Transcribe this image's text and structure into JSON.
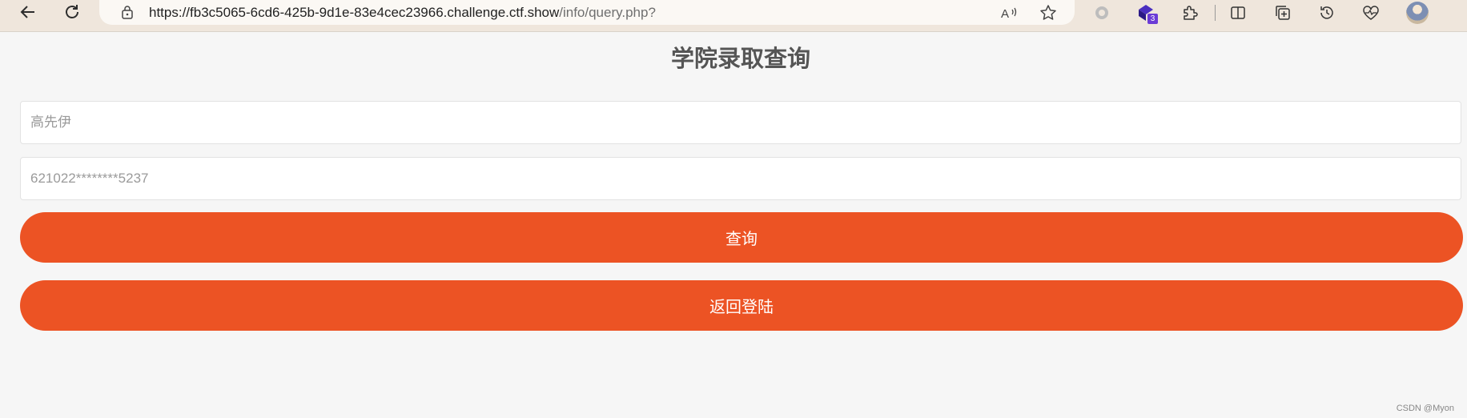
{
  "browser": {
    "url_host": "https://fb3c5065-6cd6-425b-9d1e-83e4cec23966.challenge.ctf.show",
    "url_path": "/info/query.php?",
    "extension_badge": "3",
    "icons": [
      "back-arrow-icon",
      "refresh-icon",
      "lock-icon",
      "read-aloud-icon",
      "favorite-star-icon",
      "circle-extension-icon",
      "cube-extension-icon",
      "puzzle-icon",
      "split-screen-icon",
      "collections-icon",
      "history-icon",
      "health-icon",
      "avatar"
    ]
  },
  "page": {
    "title": "学院录取查询",
    "name_input": {
      "value": "",
      "placeholder": "高先伊"
    },
    "id_input": {
      "value": "",
      "placeholder": "621022********5237"
    },
    "query_button": "查询",
    "back_button": "返回登陆"
  },
  "watermark": "CSDN @Myon⁠⁠",
  "colors": {
    "accent": "#ec5324",
    "background": "#f6f6f6",
    "toolbar": "#efe6dc"
  }
}
